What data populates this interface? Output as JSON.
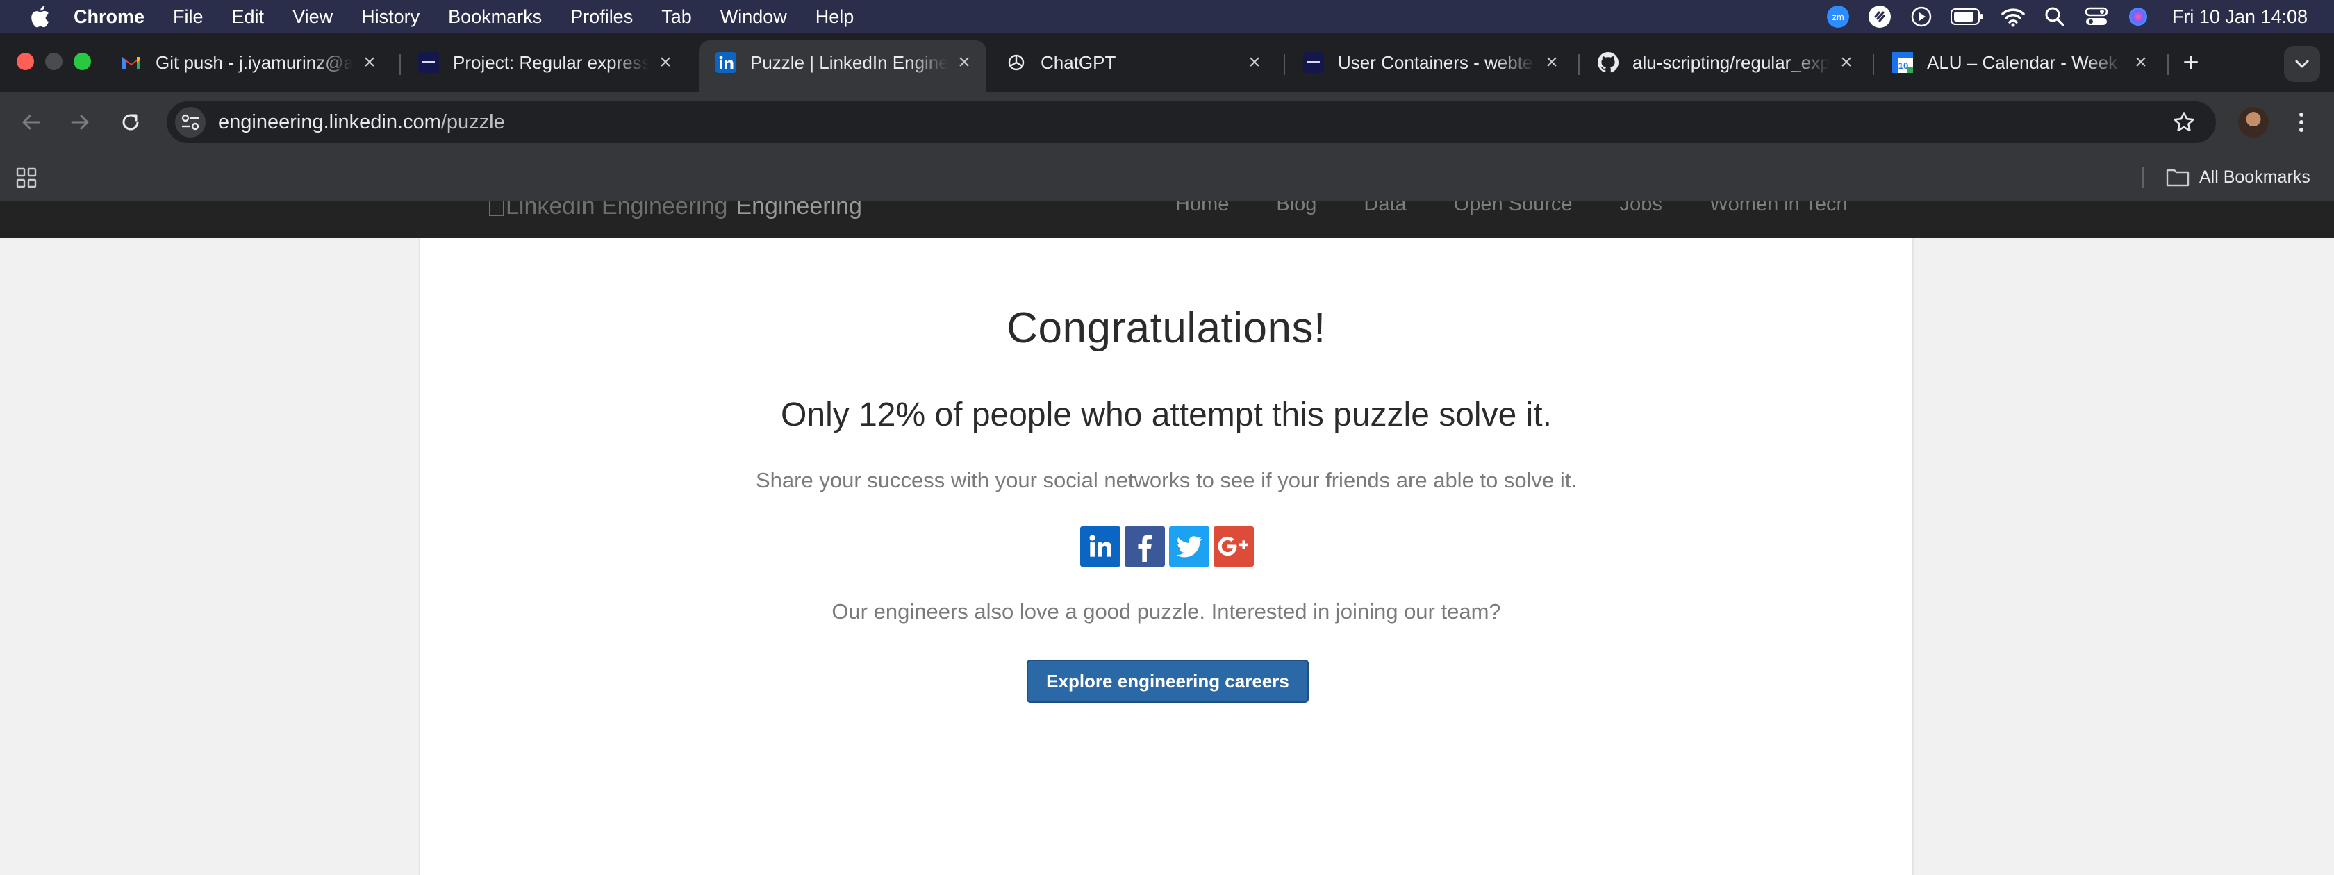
{
  "menubar": {
    "app_name": "Chrome",
    "items": [
      "File",
      "Edit",
      "View",
      "History",
      "Bookmarks",
      "Profiles",
      "Tab",
      "Window",
      "Help"
    ],
    "zoom_badge": "zm",
    "clock": "Fri 10 Jan  14:08"
  },
  "tabs": [
    {
      "title": "Git push - j.iyamurinz@al",
      "icon": "gmail-icon"
    },
    {
      "title": "Project: Regular expressi",
      "icon": "alu-icon"
    },
    {
      "title": "Puzzle | LinkedIn Enginee",
      "icon": "linkedin-icon",
      "active": true
    },
    {
      "title": "ChatGPT",
      "icon": "chatgpt-icon"
    },
    {
      "title": "User Containers - webter",
      "icon": "alu-icon"
    },
    {
      "title": "alu-scripting/regular_exp",
      "icon": "github-icon"
    },
    {
      "title": "ALU – Calendar - Week o",
      "icon": "calendar-icon"
    }
  ],
  "calendar_day": "10",
  "address_bar": {
    "host": "engineering.linkedin.com",
    "path": "/puzzle"
  },
  "bookmarks_bar": {
    "all_bookmarks": "All Bookmarks"
  },
  "site": {
    "logo_alt": "LinkedIn Engineering",
    "logo_text": "Engineering",
    "nav": [
      "Home",
      "Blog",
      "Data",
      "Open Source",
      "Jobs",
      "Women in Tech"
    ]
  },
  "content": {
    "headline": "Congratulations!",
    "stat": "Only 12% of people who attempt this puzzle solve it.",
    "share_text": "Share your success with your social networks to see if your friends are able to solve it.",
    "social": [
      "linkedin-icon",
      "facebook-icon",
      "twitter-icon",
      "google-plus-icon"
    ],
    "join_text": "Our engineers also love a good puzzle. Interested in joining our team?",
    "careers_button": "Explore engineering careers"
  },
  "colors": {
    "linkedin": "#0a66c2",
    "facebook": "#3b5998",
    "twitter": "#1da1f2",
    "google_plus": "#dd4b39",
    "careers_button": "#2a68a6"
  }
}
